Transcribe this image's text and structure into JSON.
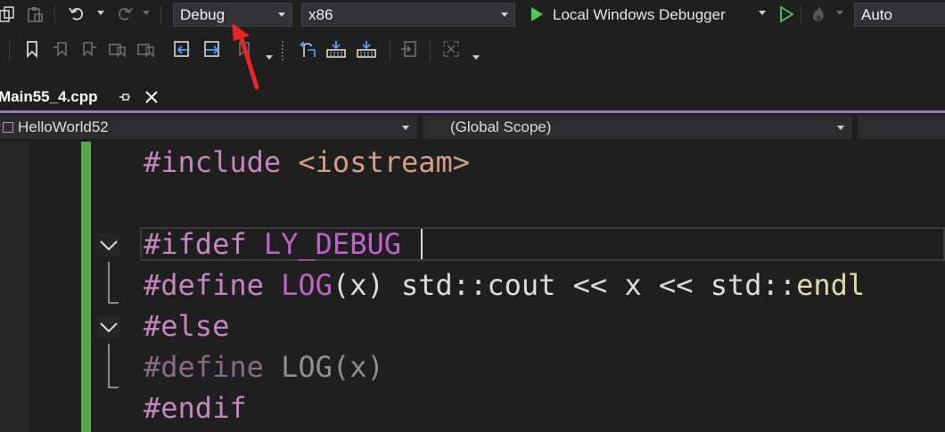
{
  "toolbar": {
    "config_value": "Debug",
    "platform_value": "x86",
    "run_label": "Local Windows Debugger",
    "auto_value": "Auto"
  },
  "tab": {
    "filename": "Main55_4.cpp"
  },
  "navbar": {
    "project": "HelloWorld52",
    "scope": "(Global Scope)"
  },
  "code": {
    "lines": [
      {
        "pp": "#include",
        "rest": "<iostream>"
      },
      {
        "pp": "",
        "rest": ""
      },
      {
        "pp": "#ifdef",
        "rest": "LY_DEBUG"
      },
      {
        "pp": "#define",
        "macro": "LOG",
        "args": "(x) std::cout << x << std::",
        "fn": "endl"
      },
      {
        "pp": "#else",
        "rest": ""
      },
      {
        "pp": "#define",
        "macro": "LOG",
        "args": "(x)"
      },
      {
        "pp": "#endif",
        "rest": ""
      }
    ]
  },
  "colors": {
    "accent_purple": "#8e7cc3",
    "change_bar_green": "#57a64a",
    "run_green": "#4ec94e",
    "annotation_red": "#e8262a"
  }
}
